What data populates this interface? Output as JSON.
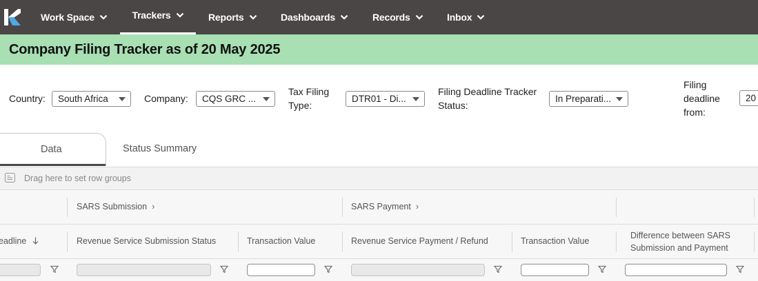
{
  "nav": {
    "items": [
      {
        "label": "Work Space"
      },
      {
        "label": "Trackers"
      },
      {
        "label": "Reports"
      },
      {
        "label": "Dashboards"
      },
      {
        "label": "Records"
      },
      {
        "label": "Inbox"
      }
    ],
    "active": "Trackers",
    "bg_color": "#4a4645"
  },
  "title": {
    "text": "Company Filing Tracker as of 20 May 2025",
    "bg_color": "#a8dfb3"
  },
  "filters": {
    "country": {
      "label": "Country:",
      "value": "South Africa"
    },
    "company": {
      "label": "Company:",
      "value": "CQS GRC ..."
    },
    "tax_filing_type": {
      "label_line1": "Tax Filing",
      "label_line2": "Type:",
      "value": "DTR01 - Di..."
    },
    "deadline_status": {
      "label_line1": "Filing Deadline Tracker",
      "label_line2": "Status:",
      "value": "In Preparati..."
    },
    "deadline_from": {
      "label_line1": "Filing",
      "label_line2": "deadline",
      "label_line3": "from:",
      "value": "20"
    }
  },
  "tabs": [
    {
      "label": "Data",
      "active": true
    },
    {
      "label": "Status Summary",
      "active": false
    }
  ],
  "grid": {
    "group_hint": "Drag here to set row groups",
    "group_headers": [
      {
        "label": "SARS Submission"
      },
      {
        "label": "SARS Payment"
      }
    ],
    "columns": [
      {
        "label": "eadline",
        "sort": "desc"
      },
      {
        "label": "Revenue Service Submission Status"
      },
      {
        "label": "Transaction Value"
      },
      {
        "label": "Revenue Service Payment / Refund"
      },
      {
        "label": "Transaction Value"
      },
      {
        "label_line1": "Difference between SARS",
        "label_line2": "Submission and Payment"
      }
    ]
  }
}
